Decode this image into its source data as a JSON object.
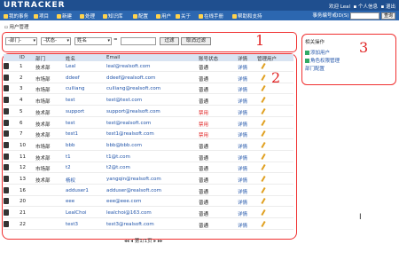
{
  "header": {
    "logo": "URTRACKER",
    "user_info": "欢迎 Leal",
    "links": [
      "个人信息",
      "退出"
    ]
  },
  "nav": {
    "items": [
      "我的事务",
      "项目",
      "新建",
      "处理",
      "知识库",
      "配置",
      "用户",
      "关于",
      "在线手册",
      "帮助和支持"
    ],
    "search_label": "事务编号或ID(S)",
    "search_value": "",
    "go_label": "查询"
  },
  "breadcrumb": "用户管理",
  "filter": {
    "dept": "-部门-",
    "status": "-状态-",
    "field": "姓名",
    "op": "=",
    "value": "",
    "filter_btn": "过滤",
    "cancel_btn": "取消过滤"
  },
  "annotations": [
    "1",
    "2",
    "3"
  ],
  "table": {
    "headers": [
      "ID",
      "部门",
      "姓名",
      "Email",
      "账号状态",
      "详情",
      "管理用户"
    ],
    "rows": [
      {
        "id": "1",
        "dept": "技术部",
        "name": "Leal",
        "email": "leal@realsoft.com",
        "status": "普通"
      },
      {
        "id": "2",
        "dept": "市场部",
        "name": "ddeef",
        "email": "ddeef@realsoft.com",
        "status": "普通"
      },
      {
        "id": "3",
        "dept": "市场部",
        "name": "cuiliang",
        "email": "cuiliang@realsoft.com",
        "status": "普通"
      },
      {
        "id": "4",
        "dept": "市场部",
        "name": "test",
        "email": "test@test.com",
        "status": "普通"
      },
      {
        "id": "5",
        "dept": "技术部",
        "name": "support",
        "email": "support@realsoft.com",
        "status": "禁用"
      },
      {
        "id": "6",
        "dept": "技术部",
        "name": "test",
        "email": "test@realsoft.com",
        "status": "禁用"
      },
      {
        "id": "7",
        "dept": "技术部",
        "name": "test1",
        "email": "test1@realsoft.com",
        "status": "禁用"
      },
      {
        "id": "10",
        "dept": "市场部",
        "name": "bbb",
        "email": "bbb@bbb.com",
        "status": "普通"
      },
      {
        "id": "11",
        "dept": "技术部",
        "name": "t1",
        "email": "t1@t.com",
        "status": "普通"
      },
      {
        "id": "12",
        "dept": "市场部",
        "name": "t2",
        "email": "t2@t.com",
        "status": "普通"
      },
      {
        "id": "13",
        "dept": "技术部",
        "name": "杨权",
        "email": "yangqin@realsoft.com",
        "status": "普通"
      },
      {
        "id": "16",
        "dept": "",
        "name": "adduser1",
        "email": "adduser@realsoft.com",
        "status": "普通"
      },
      {
        "id": "20",
        "dept": "",
        "name": "eee",
        "email": "eee@eee.com",
        "status": "普通"
      },
      {
        "id": "21",
        "dept": "",
        "name": "LealChoi",
        "email": "lealchoi@163.com",
        "status": "普通"
      },
      {
        "id": "22",
        "dept": "",
        "name": "test3",
        "email": "test3@realsoft.com",
        "status": "普通"
      }
    ],
    "detail_label": "详情",
    "pager": "第1/1页"
  },
  "sidebar": {
    "title": "相关操作",
    "links": [
      "添加用户",
      "角色权限管理",
      "部门配置"
    ]
  },
  "colors": {
    "topbar": "#1f4f8f",
    "nav": "#2c67b0",
    "annotation": "#f03030",
    "link": "#2255aa",
    "disabled": "#e02020"
  }
}
